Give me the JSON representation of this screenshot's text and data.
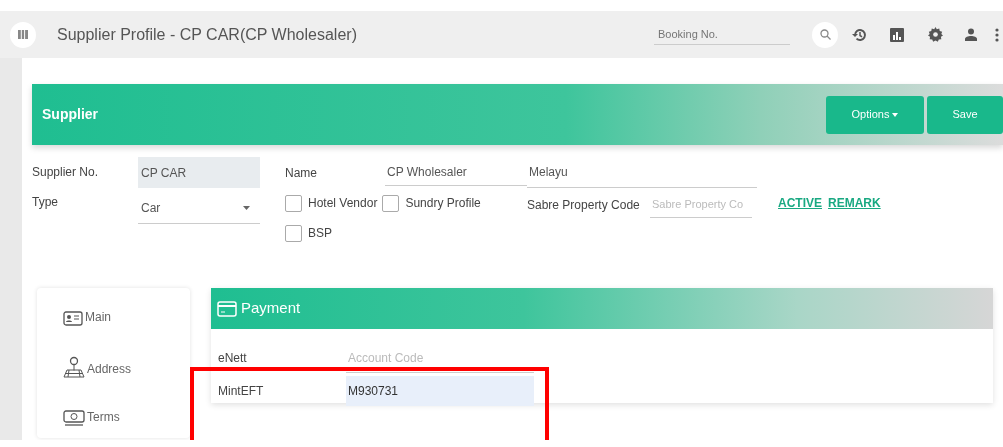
{
  "topbar": {
    "title": "Supplier Profile - CP CAR(CP Wholesaler)",
    "search": {
      "placeholder": "Booking No."
    }
  },
  "header": {
    "title": "Supplier",
    "buttons": [
      {
        "label": "Options",
        "kind": "dropdown"
      },
      {
        "label": "Save",
        "kind": "plain"
      }
    ]
  },
  "form": {
    "supplier_no": {
      "label": "Supplier No.",
      "value": "CP CAR"
    },
    "type": {
      "label": "Type",
      "value": "Car"
    },
    "name": {
      "label": "Name",
      "value": "CP Wholesaler"
    },
    "alt_name": {
      "value": "Melayu"
    },
    "checkboxes": [
      {
        "label": "Hotel Vendor",
        "checked": false
      },
      {
        "label": "Sundry Profile",
        "checked": false
      },
      {
        "label": "BSP",
        "checked": false
      }
    ],
    "sabre": {
      "label": "Sabre Property Code",
      "placeholder": "Sabre Property Co"
    },
    "links": [
      "ACTIVE",
      "REMARK"
    ]
  },
  "side_menu": [
    {
      "label": "Main"
    },
    {
      "label": "Address"
    },
    {
      "label": "Terms"
    }
  ],
  "payment": {
    "title": "Payment",
    "rows": [
      {
        "label": "eNett",
        "placeholder": "Account Code",
        "value": null,
        "focused": false
      },
      {
        "label": "MintEFT",
        "placeholder": null,
        "value": "M930731",
        "focused": true
      }
    ]
  },
  "annotation": {
    "kind": "highlight-box"
  }
}
